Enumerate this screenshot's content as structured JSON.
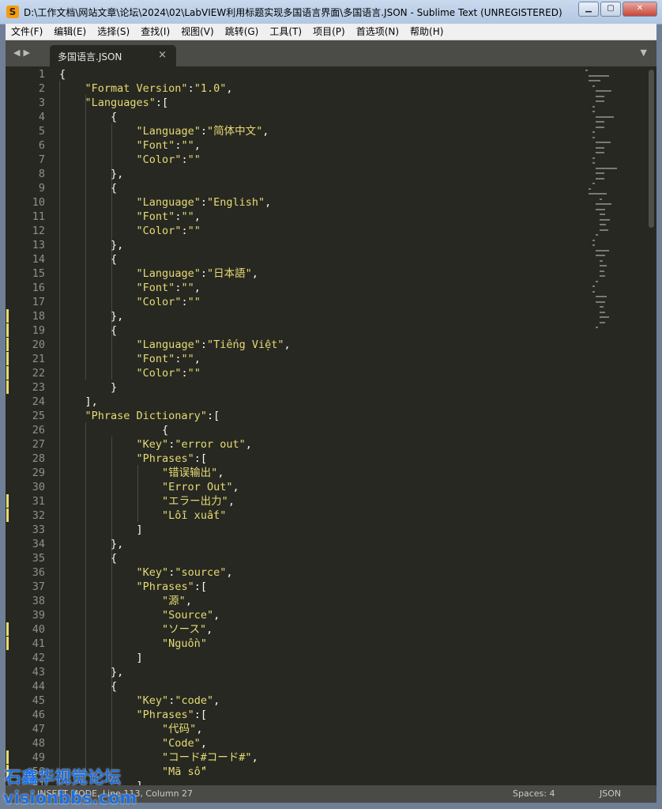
{
  "window": {
    "title": "D:\\工作文档\\网站文章\\论坛\\2024\\02\\LabVIEW利用标题实现多国语言界面\\多国语言.JSON - Sublime Text (UNREGISTERED)"
  },
  "menu": [
    "文件(F)",
    "编辑(E)",
    "选择(S)",
    "查找(I)",
    "视图(V)",
    "跳转(G)",
    "工具(T)",
    "项目(P)",
    "首选项(N)",
    "帮助(H)"
  ],
  "tab": {
    "label": "多国语言.JSON"
  },
  "status": {
    "mode": "INSERT MODE, Line 113, Column 27",
    "spaces": "Spaces: 4",
    "syntax": "JSON"
  },
  "watermark": {
    "line1": "石鑫华视觉论坛",
    "line2": "visionbbs.com"
  },
  "colors": {
    "background": "#272822",
    "string": "#e6db74",
    "text": "#f8f8f2",
    "gutter": "#8f908a",
    "modified": "#e6db74"
  },
  "modified_lines": [
    18,
    19,
    20,
    21,
    22,
    23,
    31,
    32,
    40,
    41,
    49,
    50
  ],
  "code_lines": [
    {
      "n": "1",
      "p": [
        [
          "t",
          "{"
        ]
      ]
    },
    {
      "n": "2",
      "p": [
        [
          "t",
          "    "
        ],
        [
          "s",
          "\"Format Version\""
        ],
        [
          "t",
          ":"
        ],
        [
          "s",
          "\"1.0\""
        ],
        [
          "t",
          ","
        ]
      ]
    },
    {
      "n": "3",
      "p": [
        [
          "t",
          "    "
        ],
        [
          "s",
          "\"Languages\""
        ],
        [
          "t",
          ":["
        ]
      ]
    },
    {
      "n": "4",
      "p": [
        [
          "t",
          "        {"
        ]
      ]
    },
    {
      "n": "5",
      "p": [
        [
          "t",
          "            "
        ],
        [
          "s",
          "\"Language\""
        ],
        [
          "t",
          ":"
        ],
        [
          "s",
          "\"简体中文\""
        ],
        [
          "t",
          ","
        ]
      ]
    },
    {
      "n": "6",
      "p": [
        [
          "t",
          "            "
        ],
        [
          "s",
          "\"Font\""
        ],
        [
          "t",
          ":"
        ],
        [
          "s",
          "\"\""
        ],
        [
          "t",
          ","
        ]
      ]
    },
    {
      "n": "7",
      "p": [
        [
          "t",
          "            "
        ],
        [
          "s",
          "\"Color\""
        ],
        [
          "t",
          ":"
        ],
        [
          "s",
          "\"\""
        ]
      ]
    },
    {
      "n": "8",
      "p": [
        [
          "t",
          "        },"
        ]
      ]
    },
    {
      "n": "9",
      "p": [
        [
          "t",
          "        {"
        ]
      ]
    },
    {
      "n": "10",
      "p": [
        [
          "t",
          "            "
        ],
        [
          "s",
          "\"Language\""
        ],
        [
          "t",
          ":"
        ],
        [
          "s",
          "\"English\""
        ],
        [
          "t",
          ","
        ]
      ]
    },
    {
      "n": "11",
      "p": [
        [
          "t",
          "            "
        ],
        [
          "s",
          "\"Font\""
        ],
        [
          "t",
          ":"
        ],
        [
          "s",
          "\"\""
        ],
        [
          "t",
          ","
        ]
      ]
    },
    {
      "n": "12",
      "p": [
        [
          "t",
          "            "
        ],
        [
          "s",
          "\"Color\""
        ],
        [
          "t",
          ":"
        ],
        [
          "s",
          "\"\""
        ]
      ]
    },
    {
      "n": "13",
      "p": [
        [
          "t",
          "        },"
        ]
      ]
    },
    {
      "n": "14",
      "p": [
        [
          "t",
          "        {"
        ]
      ]
    },
    {
      "n": "15",
      "p": [
        [
          "t",
          "            "
        ],
        [
          "s",
          "\"Language\""
        ],
        [
          "t",
          ":"
        ],
        [
          "s",
          "\"日本語\""
        ],
        [
          "t",
          ","
        ]
      ]
    },
    {
      "n": "16",
      "p": [
        [
          "t",
          "            "
        ],
        [
          "s",
          "\"Font\""
        ],
        [
          "t",
          ":"
        ],
        [
          "s",
          "\"\""
        ],
        [
          "t",
          ","
        ]
      ]
    },
    {
      "n": "17",
      "p": [
        [
          "t",
          "            "
        ],
        [
          "s",
          "\"Color\""
        ],
        [
          "t",
          ":"
        ],
        [
          "s",
          "\"\""
        ]
      ]
    },
    {
      "n": "18",
      "p": [
        [
          "t",
          "        },"
        ]
      ]
    },
    {
      "n": "19",
      "p": [
        [
          "t",
          "        {"
        ]
      ]
    },
    {
      "n": "20",
      "p": [
        [
          "t",
          "            "
        ],
        [
          "s",
          "\"Language\""
        ],
        [
          "t",
          ":"
        ],
        [
          "s",
          "\"Tiếng Việt\""
        ],
        [
          "t",
          ","
        ]
      ]
    },
    {
      "n": "21",
      "p": [
        [
          "t",
          "            "
        ],
        [
          "s",
          "\"Font\""
        ],
        [
          "t",
          ":"
        ],
        [
          "s",
          "\"\""
        ],
        [
          "t",
          ","
        ]
      ]
    },
    {
      "n": "22",
      "p": [
        [
          "t",
          "            "
        ],
        [
          "s",
          "\"Color\""
        ],
        [
          "t",
          ":"
        ],
        [
          "s",
          "\"\""
        ]
      ]
    },
    {
      "n": "23",
      "p": [
        [
          "t",
          "        }"
        ]
      ]
    },
    {
      "n": "24",
      "p": [
        [
          "t",
          "    ],"
        ]
      ]
    },
    {
      "n": "25",
      "p": [
        [
          "t",
          "    "
        ],
        [
          "s",
          "\"Phrase Dictionary\""
        ],
        [
          "t",
          ":["
        ]
      ]
    },
    {
      "n": "26",
      "p": [
        [
          "t",
          "                {"
        ]
      ]
    },
    {
      "n": "27",
      "p": [
        [
          "t",
          "            "
        ],
        [
          "s",
          "\"Key\""
        ],
        [
          "t",
          ":"
        ],
        [
          "s",
          "\"error out\""
        ],
        [
          "t",
          ","
        ]
      ]
    },
    {
      "n": "28",
      "p": [
        [
          "t",
          "            "
        ],
        [
          "s",
          "\"Phrases\""
        ],
        [
          "t",
          ":["
        ]
      ]
    },
    {
      "n": "29",
      "p": [
        [
          "t",
          "                "
        ],
        [
          "s",
          "\"错误输出\""
        ],
        [
          "t",
          ","
        ]
      ]
    },
    {
      "n": "30",
      "p": [
        [
          "t",
          "                "
        ],
        [
          "s",
          "\"Error Out\""
        ],
        [
          "t",
          ","
        ]
      ]
    },
    {
      "n": "31",
      "p": [
        [
          "t",
          "                "
        ],
        [
          "s",
          "\"エラー出力\""
        ],
        [
          "t",
          ","
        ]
      ]
    },
    {
      "n": "32",
      "p": [
        [
          "t",
          "                "
        ],
        [
          "s",
          "\"Lỗi xuất\""
        ]
      ]
    },
    {
      "n": "33",
      "p": [
        [
          "t",
          "            ]"
        ]
      ]
    },
    {
      "n": "34",
      "p": [
        [
          "t",
          "        },"
        ]
      ]
    },
    {
      "n": "35",
      "p": [
        [
          "t",
          "        {"
        ]
      ]
    },
    {
      "n": "36",
      "p": [
        [
          "t",
          "            "
        ],
        [
          "s",
          "\"Key\""
        ],
        [
          "t",
          ":"
        ],
        [
          "s",
          "\"source\""
        ],
        [
          "t",
          ","
        ]
      ]
    },
    {
      "n": "37",
      "p": [
        [
          "t",
          "            "
        ],
        [
          "s",
          "\"Phrases\""
        ],
        [
          "t",
          ":["
        ]
      ]
    },
    {
      "n": "38",
      "p": [
        [
          "t",
          "                "
        ],
        [
          "s",
          "\"源\""
        ],
        [
          "t",
          ","
        ]
      ]
    },
    {
      "n": "39",
      "p": [
        [
          "t",
          "                "
        ],
        [
          "s",
          "\"Source\""
        ],
        [
          "t",
          ","
        ]
      ]
    },
    {
      "n": "40",
      "p": [
        [
          "t",
          "                "
        ],
        [
          "s",
          "\"ソース\""
        ],
        [
          "t",
          ","
        ]
      ]
    },
    {
      "n": "41",
      "p": [
        [
          "t",
          "                "
        ],
        [
          "s",
          "\"Nguồn\""
        ]
      ]
    },
    {
      "n": "42",
      "p": [
        [
          "t",
          "            ]"
        ]
      ]
    },
    {
      "n": "43",
      "p": [
        [
          "t",
          "        },"
        ]
      ]
    },
    {
      "n": "44",
      "p": [
        [
          "t",
          "        {"
        ]
      ]
    },
    {
      "n": "45",
      "p": [
        [
          "t",
          "            "
        ],
        [
          "s",
          "\"Key\""
        ],
        [
          "t",
          ":"
        ],
        [
          "s",
          "\"code\""
        ],
        [
          "t",
          ","
        ]
      ]
    },
    {
      "n": "46",
      "p": [
        [
          "t",
          "            "
        ],
        [
          "s",
          "\"Phrases\""
        ],
        [
          "t",
          ":["
        ]
      ]
    },
    {
      "n": "47",
      "p": [
        [
          "t",
          "                "
        ],
        [
          "s",
          "\"代码\""
        ],
        [
          "t",
          ","
        ]
      ]
    },
    {
      "n": "48",
      "p": [
        [
          "t",
          "                "
        ],
        [
          "s",
          "\"Code\""
        ],
        [
          "t",
          ","
        ]
      ]
    },
    {
      "n": "49",
      "p": [
        [
          "t",
          "                "
        ],
        [
          "s",
          "\"コード#コード#\""
        ],
        [
          "t",
          ","
        ]
      ]
    },
    {
      "n": "50",
      "p": [
        [
          "t",
          "                "
        ],
        [
          "s",
          "\"Mã số\""
        ]
      ]
    },
    {
      "n": "51",
      "p": [
        [
          "t",
          "            ]"
        ]
      ]
    }
  ]
}
